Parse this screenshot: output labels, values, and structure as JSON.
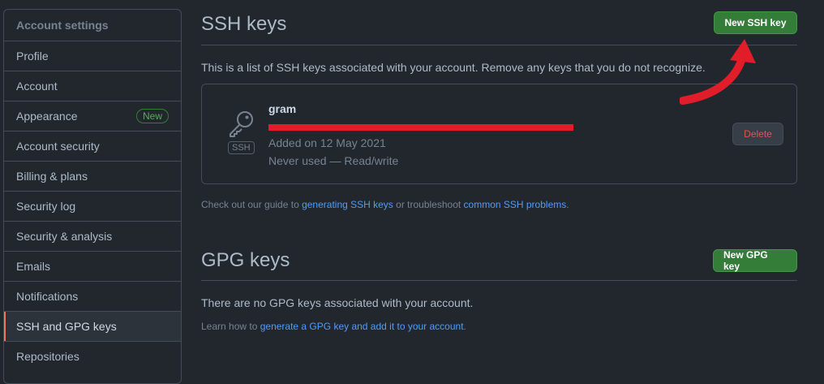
{
  "sidebar": {
    "header": "Account settings",
    "items": [
      {
        "label": "Profile"
      },
      {
        "label": "Account"
      },
      {
        "label": "Appearance",
        "badge": "New"
      },
      {
        "label": "Account security"
      },
      {
        "label": "Billing & plans"
      },
      {
        "label": "Security log"
      },
      {
        "label": "Security & analysis"
      },
      {
        "label": "Emails"
      },
      {
        "label": "Notifications"
      },
      {
        "label": "SSH and GPG keys"
      },
      {
        "label": "Repositories"
      }
    ]
  },
  "ssh": {
    "title": "SSH keys",
    "new_button": "New SSH key",
    "description": "This is a list of SSH keys associated with your account. Remove any keys that you do not recognize.",
    "key": {
      "name": "gram",
      "type_label": "SSH",
      "added": "Added on 12 May 2021",
      "usage": "Never used — Read/write",
      "delete_label": "Delete"
    },
    "guide_prefix": "Check out our guide to ",
    "guide_link": "generating SSH keys",
    "guide_middle": " or troubleshoot ",
    "guide_link2": "common SSH problems",
    "guide_suffix": "."
  },
  "gpg": {
    "title": "GPG keys",
    "new_button": "New GPG key",
    "empty_text": "There are no GPG keys associated with your account.",
    "learn_prefix": "Learn how to ",
    "learn_link": "generate a GPG key and add it to your account",
    "learn_suffix": "."
  },
  "colors": {
    "background": "#22272e",
    "accent_green": "#347d39",
    "link": "#539bf5",
    "danger": "#e5534b",
    "annotation_red": "#e11d2a",
    "active_marker": "#ec775c"
  },
  "icons": [
    "key-icon",
    "red-arrow-annotation"
  ]
}
